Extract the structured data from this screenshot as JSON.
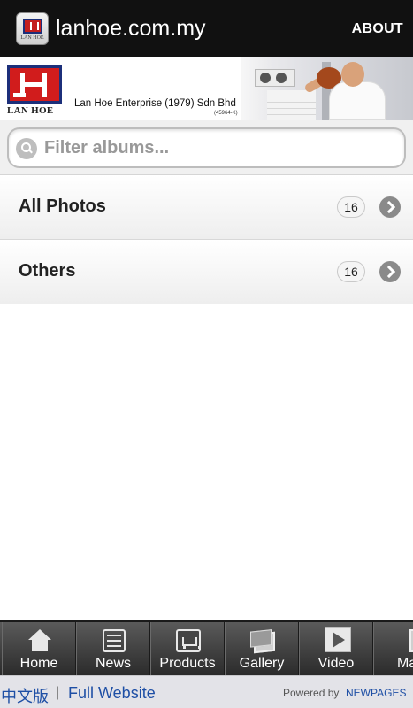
{
  "actionbar": {
    "title": "lanhoe.com.my",
    "about_label": "ABOUT",
    "icon_text": "LAN HOE"
  },
  "banner": {
    "logo_text": "LAN HOE",
    "company_name": "Lan Hoe Enterprise (1979) Sdn Bhd",
    "reg_no": "(45964-K)"
  },
  "search": {
    "placeholder": "Filter albums...",
    "value": ""
  },
  "albums": [
    {
      "label": "All Photos",
      "count": "16"
    },
    {
      "label": "Others",
      "count": "16"
    }
  ],
  "tabs": [
    {
      "label": "Home",
      "icon": "home-icon"
    },
    {
      "label": "News",
      "icon": "news-icon"
    },
    {
      "label": "Products",
      "icon": "cart-icon"
    },
    {
      "label": "Gallery",
      "icon": "gallery-icon"
    },
    {
      "label": "Video",
      "icon": "video-icon"
    },
    {
      "label": "Ma",
      "icon": "more-icon"
    }
  ],
  "footer": {
    "chinese_link": "中文版",
    "separator": "|",
    "full_website": "Full Website",
    "powered_by": "Powered by",
    "powered_brand": "NEWPAGES"
  },
  "colors": {
    "actionbar": "#111111",
    "link": "#1e4fa5",
    "logo_red": "#d11c1c",
    "logo_navy": "#1c2f7a"
  }
}
